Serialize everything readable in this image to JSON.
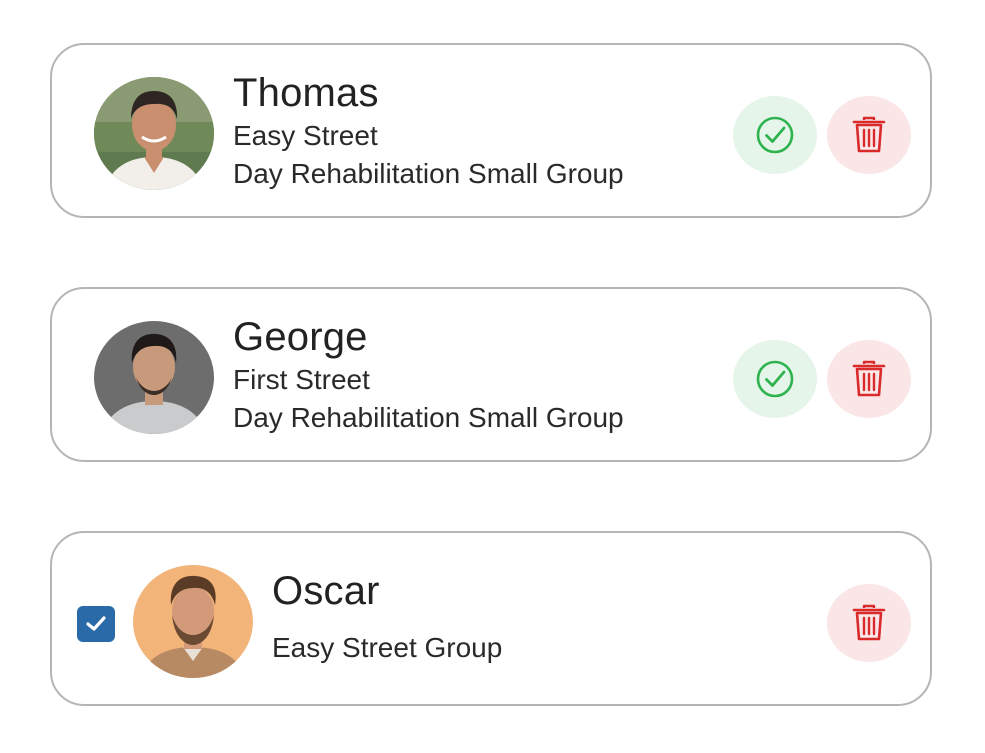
{
  "colors": {
    "card_border": "#b5b5b5",
    "approve_bg": "#e6f5ea",
    "approve_icon": "#2fb34f",
    "delete_bg": "#fbe6e7",
    "delete_icon": "#d92b2b",
    "checkbox": "#2b6aa8"
  },
  "cards": [
    {
      "name": "Thomas",
      "street": "Easy Street",
      "program": "Day Rehabilitation Small Group",
      "avatar": "man-smiling-photo",
      "actions": [
        "check-circle-icon",
        "trash-icon"
      ]
    },
    {
      "name": "George",
      "street": "First Street",
      "program": "Day Rehabilitation Small Group",
      "avatar": "man-grey-sweater-photo",
      "actions": [
        "check-circle-icon",
        "trash-icon"
      ]
    },
    {
      "name": "Oscar",
      "group": "Easy Street Group",
      "avatar": "bearded-man-photo",
      "selected": true,
      "actions": [
        "trash-icon"
      ]
    }
  ]
}
